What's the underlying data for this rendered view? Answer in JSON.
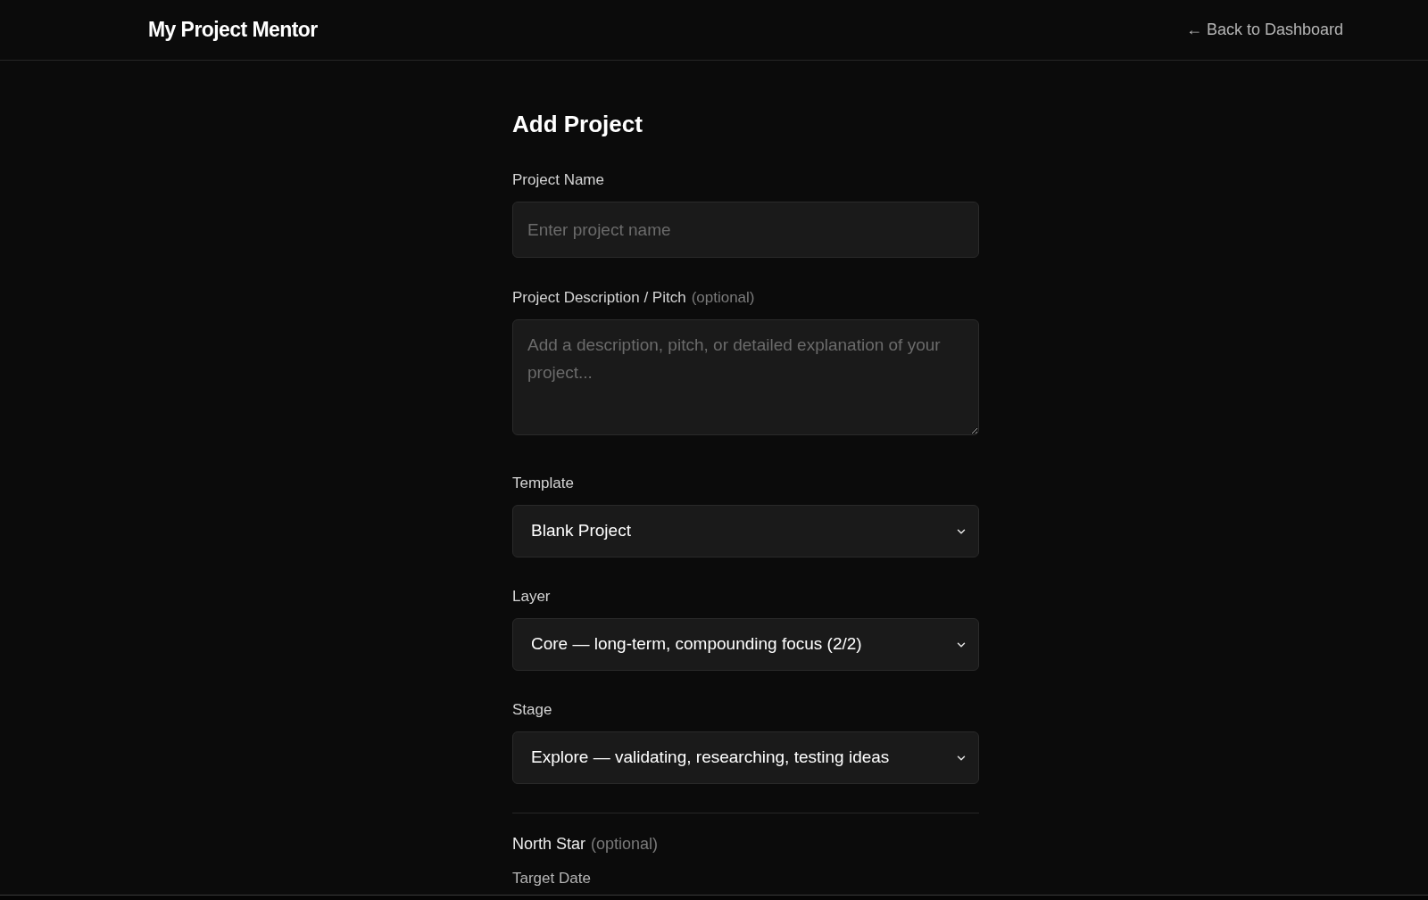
{
  "header": {
    "title": "My Project Mentor",
    "back_link": "← Back to Dashboard"
  },
  "form": {
    "title": "Add Project",
    "fields": [
      {
        "kind": "text",
        "label": "Project Name",
        "placeholder": "Enter project name"
      },
      {
        "kind": "textarea",
        "label": "Project Description / Pitch",
        "hint": "(optional)",
        "placeholder": "Add a description, pitch, or detailed explanation of your project..."
      },
      {
        "kind": "select",
        "label": "Template",
        "value": "Blank Project"
      },
      {
        "kind": "select",
        "label": "Layer",
        "value": "Core — long-term, compounding focus (2/2)"
      },
      {
        "kind": "select",
        "label": "Stage",
        "value": "Explore — validating, researching, testing ideas"
      }
    ],
    "north_star": {
      "label": "North Star",
      "hint": "(optional)"
    },
    "target_date": {
      "label": "Target Date"
    }
  }
}
